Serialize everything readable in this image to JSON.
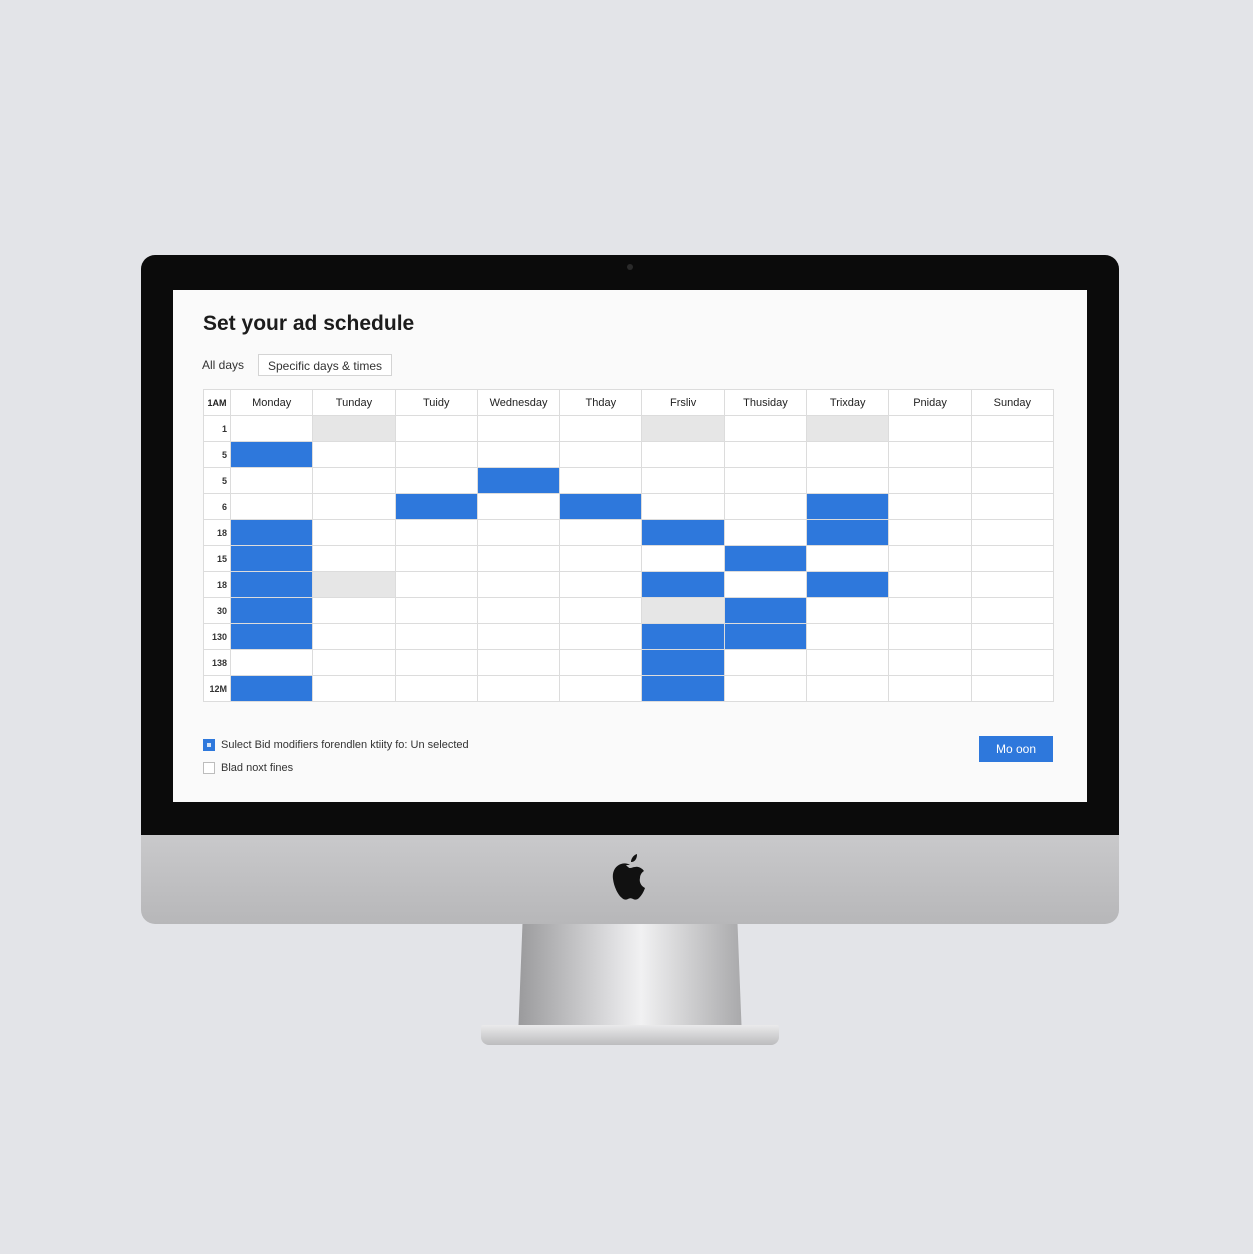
{
  "page": {
    "title": "Set your ad schedule",
    "tabs": {
      "all_days": "All days",
      "specific": "Specific days & times"
    }
  },
  "schedule": {
    "corner_label": "1AM",
    "days": [
      "Monday",
      "Tunday",
      "Tuidy",
      "Wednesday",
      "Thday",
      "Frsliv",
      "Thusiday",
      "Trixday",
      "Pniday",
      "Sunday"
    ],
    "rows": [
      {
        "hour": "1",
        "selected": [],
        "shaded": [
          1,
          5,
          7
        ]
      },
      {
        "hour": "5",
        "selected": [
          0
        ],
        "shaded": []
      },
      {
        "hour": "5",
        "selected": [
          3
        ],
        "shaded": []
      },
      {
        "hour": "6",
        "selected": [
          2,
          4,
          7
        ],
        "shaded": []
      },
      {
        "hour": "18",
        "selected": [
          0,
          5,
          7
        ],
        "shaded": []
      },
      {
        "hour": "15",
        "selected": [
          0,
          6
        ],
        "shaded": []
      },
      {
        "hour": "18",
        "selected": [
          0,
          5,
          7
        ],
        "shaded": [
          1
        ]
      },
      {
        "hour": "30",
        "selected": [
          0,
          6
        ],
        "shaded": [
          5
        ]
      },
      {
        "hour": "130",
        "selected": [
          0,
          5,
          6
        ],
        "shaded": []
      },
      {
        "hour": "138",
        "selected": [
          5
        ],
        "shaded": []
      },
      {
        "hour": "12M",
        "selected": [
          0,
          5
        ],
        "shaded": []
      }
    ]
  },
  "options": {
    "bid_modifiers": {
      "label": "Sulect Bid modifiers forendlen ktiity fo: Un selected",
      "checked": true
    },
    "blad_next": {
      "label": "Blad noxt fines",
      "checked": false
    }
  },
  "actions": {
    "primary_button": "Mo oon"
  },
  "colors": {
    "selected": "#2e78dc",
    "shaded": "#e6e6e6",
    "accent": "#2e78dc"
  }
}
